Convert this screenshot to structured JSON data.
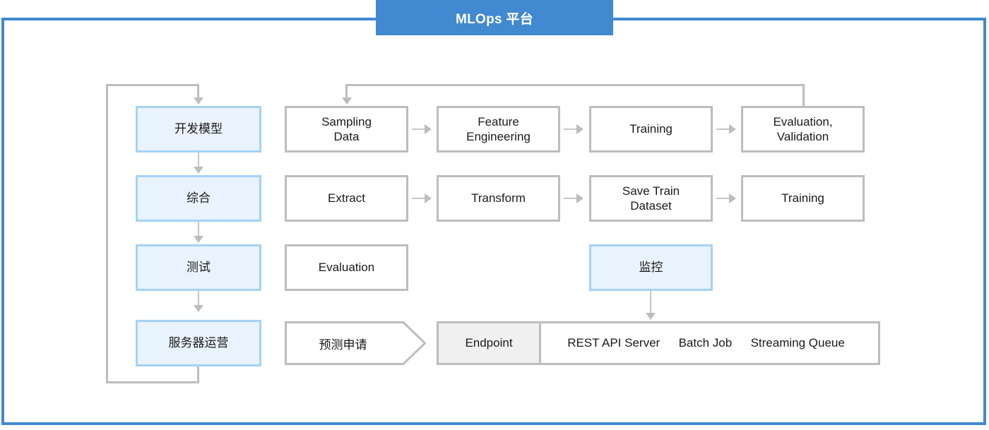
{
  "header": {
    "title": "MLOps 平台",
    "banner_color": "#4189d0",
    "frame_border_color": "#4189d0"
  },
  "lifecycle_column": {
    "name": "lifecycle-stages",
    "accent_fill": "#e9f3fd",
    "accent_border": "#a5d2f5",
    "items": [
      {
        "label": "开发模型"
      },
      {
        "label": "综合"
      },
      {
        "label": "测试"
      },
      {
        "label": "服务器运营"
      }
    ],
    "feedback_loop": true
  },
  "rows": [
    {
      "name": "model-development-pipeline",
      "steps": [
        {
          "label": "Sampling\nData",
          "line1": "Sampling",
          "line2": "Data"
        },
        {
          "label": "Feature\nEngineering",
          "line1": "Feature",
          "line2": "Engineering"
        },
        {
          "label": "Training",
          "line1": "Training",
          "line2": ""
        },
        {
          "label": "Evaluation,\nValidation",
          "line1": "Evaluation,",
          "line2": "Validation"
        }
      ],
      "feedback_arrow": true
    },
    {
      "name": "integration-pipeline",
      "steps": [
        {
          "label": "Extract",
          "line1": "Extract",
          "line2": ""
        },
        {
          "label": "Transform",
          "line1": "Transform",
          "line2": ""
        },
        {
          "label": "Save Train\nDataset",
          "line1": "Save Train",
          "line2": "Dataset"
        },
        {
          "label": "Training",
          "line1": "Training",
          "line2": ""
        }
      ],
      "feedback_arrow": false
    },
    {
      "name": "test-and-monitor-row",
      "steps": [
        {
          "label": "Evaluation",
          "line1": "Evaluation",
          "line2": ""
        },
        {
          "label": "监控",
          "line1": "监控",
          "line2": ""
        }
      ]
    }
  ],
  "serving_row": {
    "name": "serving-row",
    "request_label": "预测申请",
    "endpoint_label": "Endpoint",
    "channels": [
      "REST API Server",
      "Batch Job",
      "Streaming Queue"
    ]
  }
}
